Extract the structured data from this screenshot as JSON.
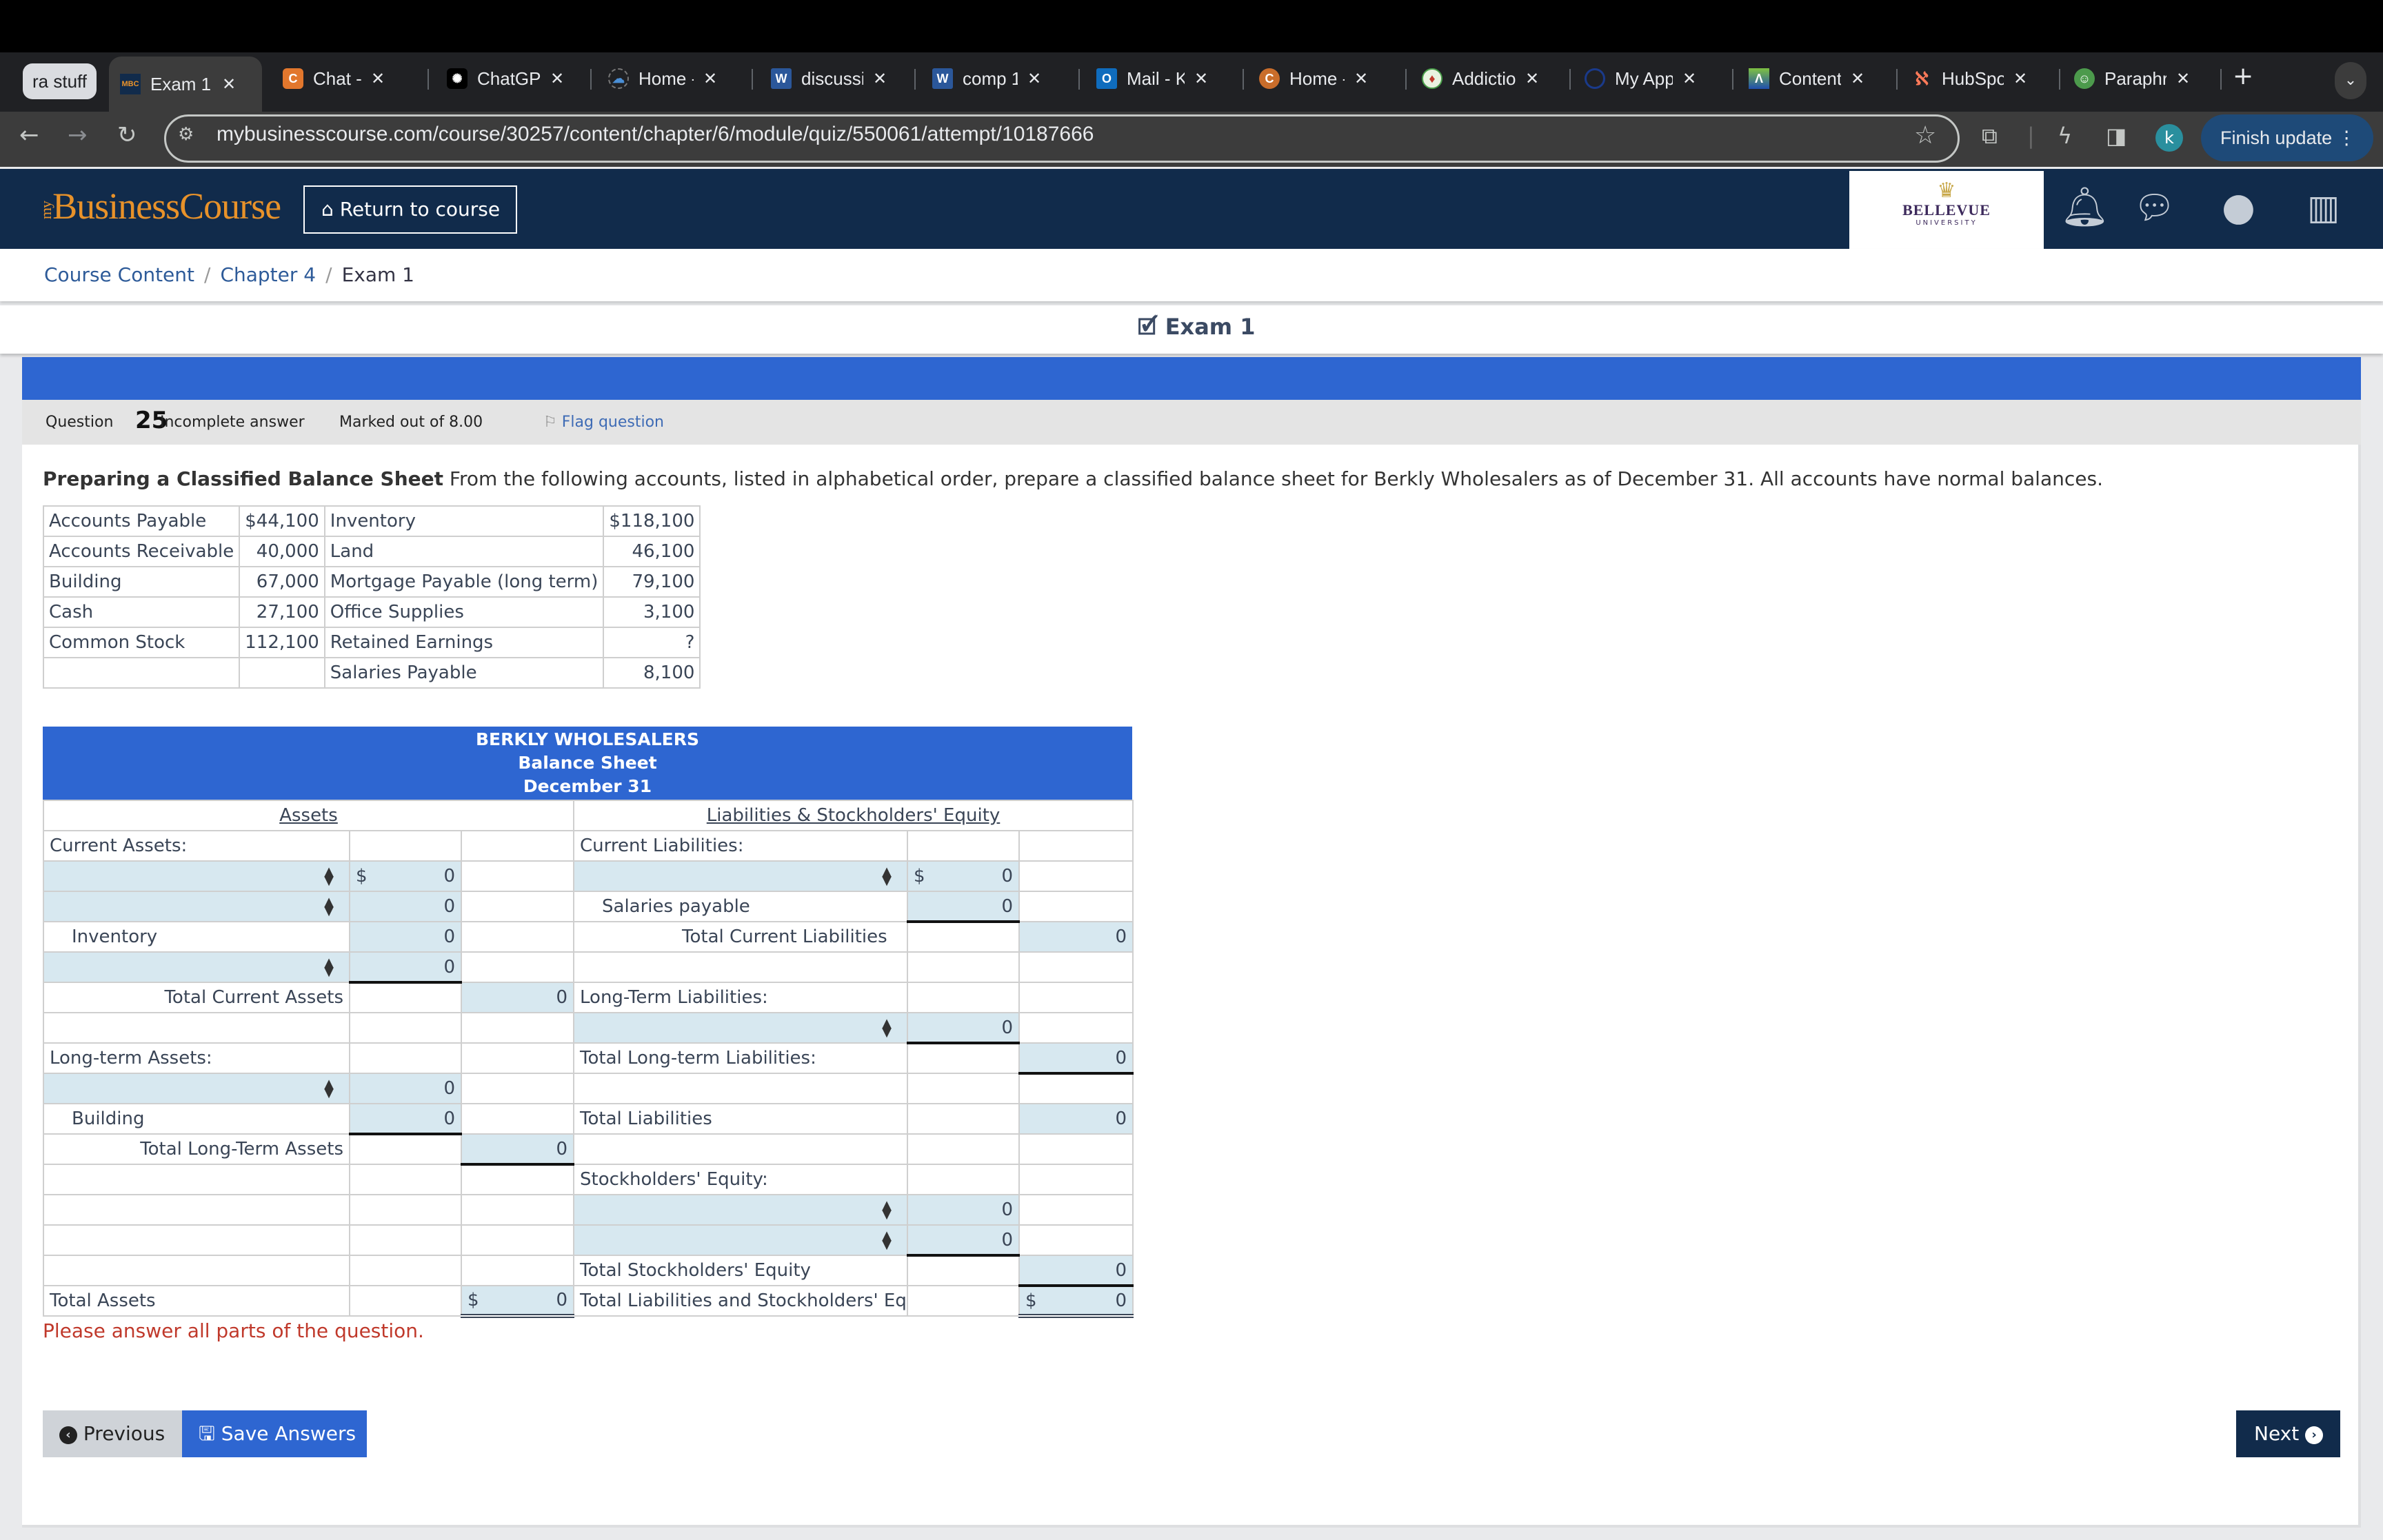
{
  "browser": {
    "tab_group": "ra stuff",
    "tabs": [
      {
        "label": "Exam 1 |",
        "favicon": "MBC",
        "active": true
      },
      {
        "label": "Chat - L",
        "favicon": "C"
      },
      {
        "label": "ChatGPT",
        "favicon": "openai"
      },
      {
        "label": "Home -",
        "favicon": "cloud"
      },
      {
        "label": "discussi",
        "favicon": "W"
      },
      {
        "label": "comp 1",
        "favicon": "W"
      },
      {
        "label": "Mail - Ke",
        "favicon": "O"
      },
      {
        "label": "Home -",
        "favicon": "C"
      },
      {
        "label": "Addictio",
        "favicon": "cards"
      },
      {
        "label": "My Apps",
        "favicon": "O"
      },
      {
        "label": "Content",
        "favicon": "A"
      },
      {
        "label": "HubSpot",
        "favicon": "hubspot"
      },
      {
        "label": "Paraphra",
        "favicon": "robot"
      }
    ],
    "new_tab": "+",
    "url": "mybusinesscourse.com/course/30257/content/chapter/6/module/quiz/550061/attempt/10187666",
    "profile_initial": "k",
    "finish_update": "Finish update"
  },
  "app": {
    "logo_my": "my",
    "logo": "BusinessCourse",
    "return_button": "Return to course",
    "university": "BELLEVUE",
    "university_sub": "UNIVERSITY"
  },
  "breadcrumb": [
    "Course Content",
    "Chapter 4",
    "Exam 1"
  ],
  "exam_title": "Exam 1",
  "question": {
    "label": "Question",
    "number": "25",
    "status": "Incomplete answer",
    "marked": "Marked out of 8.00",
    "flag": "Flag question",
    "prompt_bold": "Preparing a Classified Balance Sheet",
    "prompt": " From the following accounts, listed in alphabetical order, prepare a classified balance sheet for Berkly Wholesalers as of December 31. All accounts have normal balances."
  },
  "accounts": [
    [
      "Accounts Payable",
      "$44,100",
      "Inventory",
      "$118,100"
    ],
    [
      "Accounts Receivable",
      "40,000",
      "Land",
      "46,100"
    ],
    [
      "Building",
      "67,000",
      "Mortgage Payable (long term)",
      "79,100"
    ],
    [
      "Cash",
      "27,100",
      "Office Supplies",
      "3,100"
    ],
    [
      "Common Stock",
      "112,100",
      "Retained Earnings",
      "?"
    ],
    [
      "",
      "",
      "Salaries Payable",
      "8,100"
    ]
  ],
  "balance_sheet": {
    "company": "BERKLY WHOLESALERS",
    "title": "Balance Sheet",
    "date": "December 31",
    "assets_header": "Assets",
    "liab_header": "Liabilities & Stockholders' Equity",
    "current_assets": "Current Assets:",
    "inventory": "Inventory",
    "total_current_assets": "Total Current Assets",
    "longterm_assets": "Long-term Assets:",
    "building": "Building",
    "total_longterm_assets": "Total Long-Term Assets",
    "total_assets": "Total Assets",
    "current_liabilities": "Current Liabilities:",
    "salaries_payable": "Salaries payable",
    "total_current_liabilities": "Total Current Liabilities",
    "longterm_liabilities": "Long-Term Liabilities:",
    "total_longterm_liabilities": "Total Long-term Liabilities:",
    "total_liabilities": "Total Liabilities",
    "stockholders_equity": "Stockholders' Equity:",
    "total_stockholders_equity": "Total Stockholders' Equity",
    "total_liab_equity": "Total Liabilities and Stockholders' Equity",
    "dollar": "$",
    "values": {
      "ca1": "0",
      "ca2": "0",
      "inventory": "0",
      "ca4": "0",
      "total_current_assets": "0",
      "la1": "0",
      "building": "0",
      "total_longterm_assets": "0",
      "total_assets": "0",
      "cl1": "0",
      "salaries_payable": "0",
      "total_current_liabilities": "0",
      "ll1": "0",
      "total_longterm_liabilities": "0",
      "total_liabilities": "0",
      "se1": "0",
      "se2": "0",
      "total_stockholders_equity": "0",
      "total_liab_equity": "0"
    }
  },
  "warning": "Please answer all parts of the question.",
  "buttons": {
    "previous": "Previous",
    "save": "Save Answers",
    "next": "Next"
  }
}
